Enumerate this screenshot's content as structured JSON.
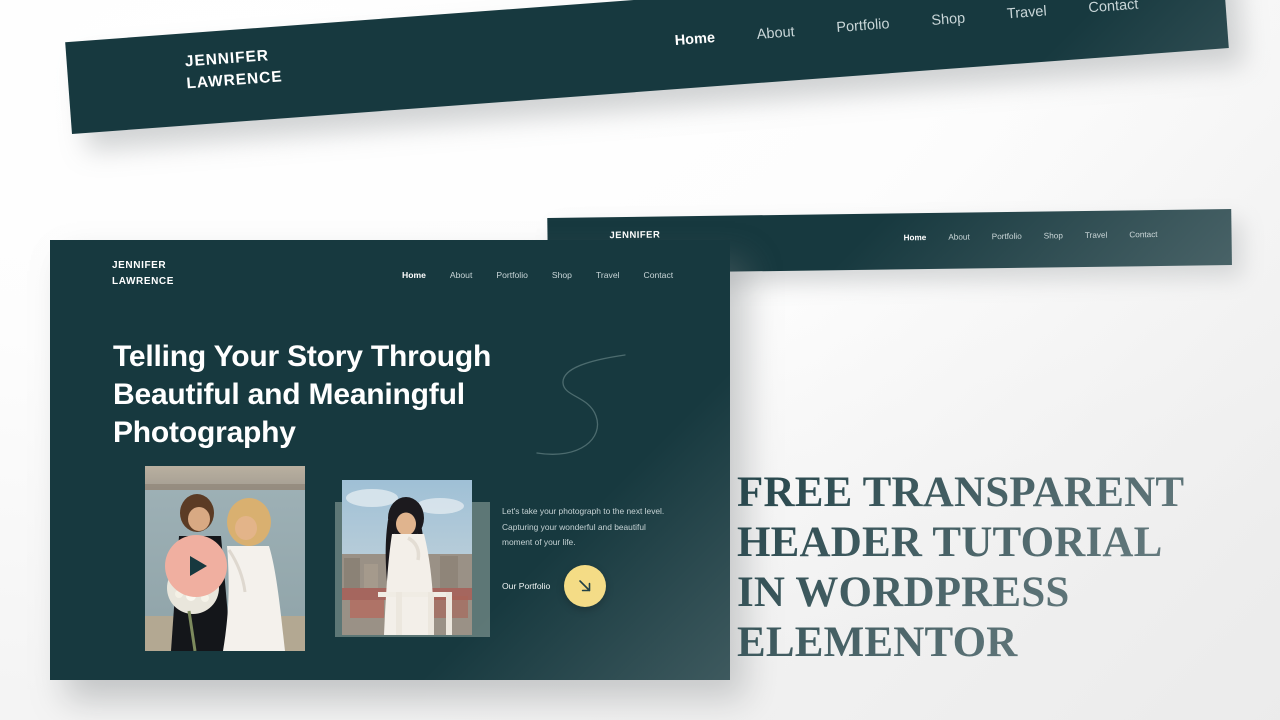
{
  "meta": {
    "teal": "#17393F",
    "yellow": "#F5DC82",
    "pink": "#F0AFA0",
    "nav_inactive": "#c9d6d8",
    "page_bg": "#ffffff"
  },
  "brand": {
    "line1": "JENNIFER",
    "line2": "LAWRENCE"
  },
  "nav": {
    "items": [
      {
        "label": "Home",
        "active": true
      },
      {
        "label": "About",
        "active": false
      },
      {
        "label": "Portfolio",
        "active": false
      },
      {
        "label": "Shop",
        "active": false
      },
      {
        "label": "Travel",
        "active": false
      },
      {
        "label": "Contact",
        "active": false
      }
    ]
  },
  "hero": {
    "title_line1": "Telling Your Story Through",
    "title_line2": "Beautiful and Meaningful",
    "title_line3": "Photography",
    "lede": "Let's take your photograph to the next level. Capturing your wonderful and beautiful moment of your life.",
    "cta_label": "Our Portfolio",
    "cta_icon": "arrow-down-right-icon",
    "play_icon": "play-icon",
    "squiggle_icon": "squiggle-decoration-icon",
    "photo1_alt": "wedding-couple-by-the-water",
    "photo2_alt": "woman-in-white-dress-on-rooftop"
  },
  "overlay_title": {
    "line1": "FREE TRANSPARENT",
    "line2": "HEADER TUTORIAL",
    "line3": "IN WORDPRESS",
    "line4": "ELEMENTOR"
  }
}
